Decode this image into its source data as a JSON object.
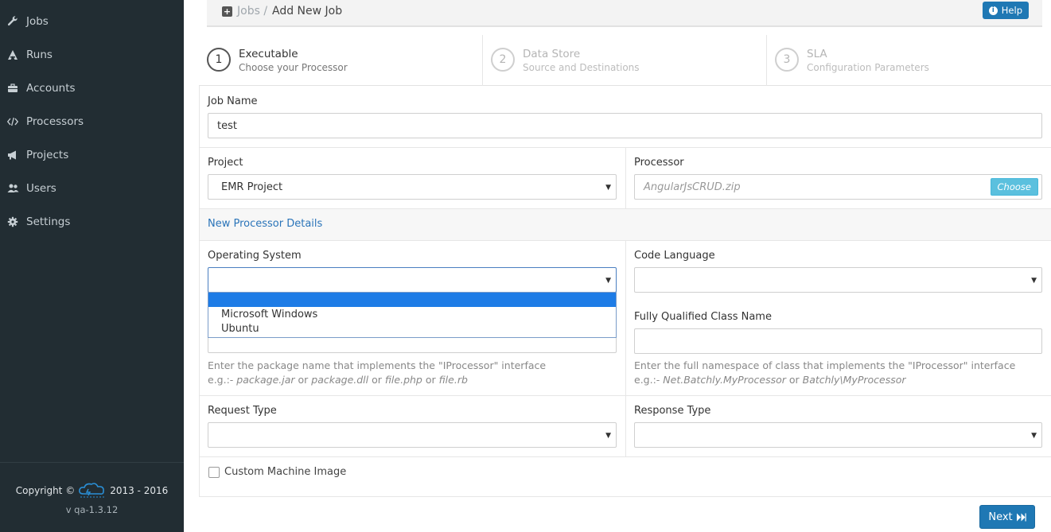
{
  "sidebar": {
    "items": [
      {
        "label": "Jobs",
        "icon": "wrench-icon"
      },
      {
        "label": "Runs",
        "icon": "runner-icon"
      },
      {
        "label": "Accounts",
        "icon": "briefcase-icon"
      },
      {
        "label": "Processors",
        "icon": "code-icon"
      },
      {
        "label": "Projects",
        "icon": "bullhorn-icon"
      },
      {
        "label": "Users",
        "icon": "users-icon"
      },
      {
        "label": "Settings",
        "icon": "gear-icon"
      }
    ],
    "copyright_prefix": "Copyright ©",
    "copyright_years": "2013 - 2016",
    "version": "v qa-1.3.12"
  },
  "header": {
    "breadcrumb_parent": "Jobs",
    "breadcrumb_separator": "/",
    "breadcrumb_current": "Add New Job",
    "help_label": "Help"
  },
  "wizard": {
    "steps": [
      {
        "number": "1",
        "title": "Executable",
        "subtitle": "Choose your Processor"
      },
      {
        "number": "2",
        "title": "Data Store",
        "subtitle": "Source and Destinations"
      },
      {
        "number": "3",
        "title": "SLA",
        "subtitle": "Configuration Parameters"
      }
    ]
  },
  "form": {
    "job_name_label": "Job Name",
    "job_name_value": "test",
    "project_label": "Project",
    "project_value": "EMR Project",
    "processor_label": "Processor",
    "processor_value": "AngularJsCRUD.zip",
    "choose_label": "Choose",
    "new_processor_heading": "New Processor Details",
    "os_label": "Operating System",
    "os_value": "",
    "os_options": [
      "",
      "Microsoft Windows",
      "Ubuntu"
    ],
    "code_language_label": "Code Language",
    "code_language_value": "",
    "fqcn_label": "Fully Qualified Class Name",
    "fqcn_value": "",
    "package_help_line1": "Enter the package name that implements the \"IProcessor\" interface",
    "package_help_eg": "e.g.:- ",
    "package_help_ex1": "package.jar",
    "package_help_or1": " or ",
    "package_help_ex2": "package.dll",
    "package_help_or2": " or ",
    "package_help_ex3": "file.php",
    "package_help_or3": " or ",
    "package_help_ex4": "file.rb",
    "fqcn_help_line1": "Enter the full namespace of class that implements the \"IProcessor\" interface",
    "fqcn_help_eg": "e.g.:- ",
    "fqcn_help_ex1": "Net.Batchly.MyProcessor",
    "fqcn_help_or": " or ",
    "fqcn_help_ex2": "Batchly\\MyProcessor",
    "request_type_label": "Request Type",
    "request_type_value": "",
    "response_type_label": "Response Type",
    "response_type_value": "",
    "custom_image_label": "Custom Machine Image",
    "next_label": "Next"
  },
  "colors": {
    "sidebar_bg": "#222d33",
    "primary": "#1f78b4",
    "info": "#5bc0de",
    "link": "#2a74b9",
    "dropdown_highlight": "#1e7ce6"
  }
}
